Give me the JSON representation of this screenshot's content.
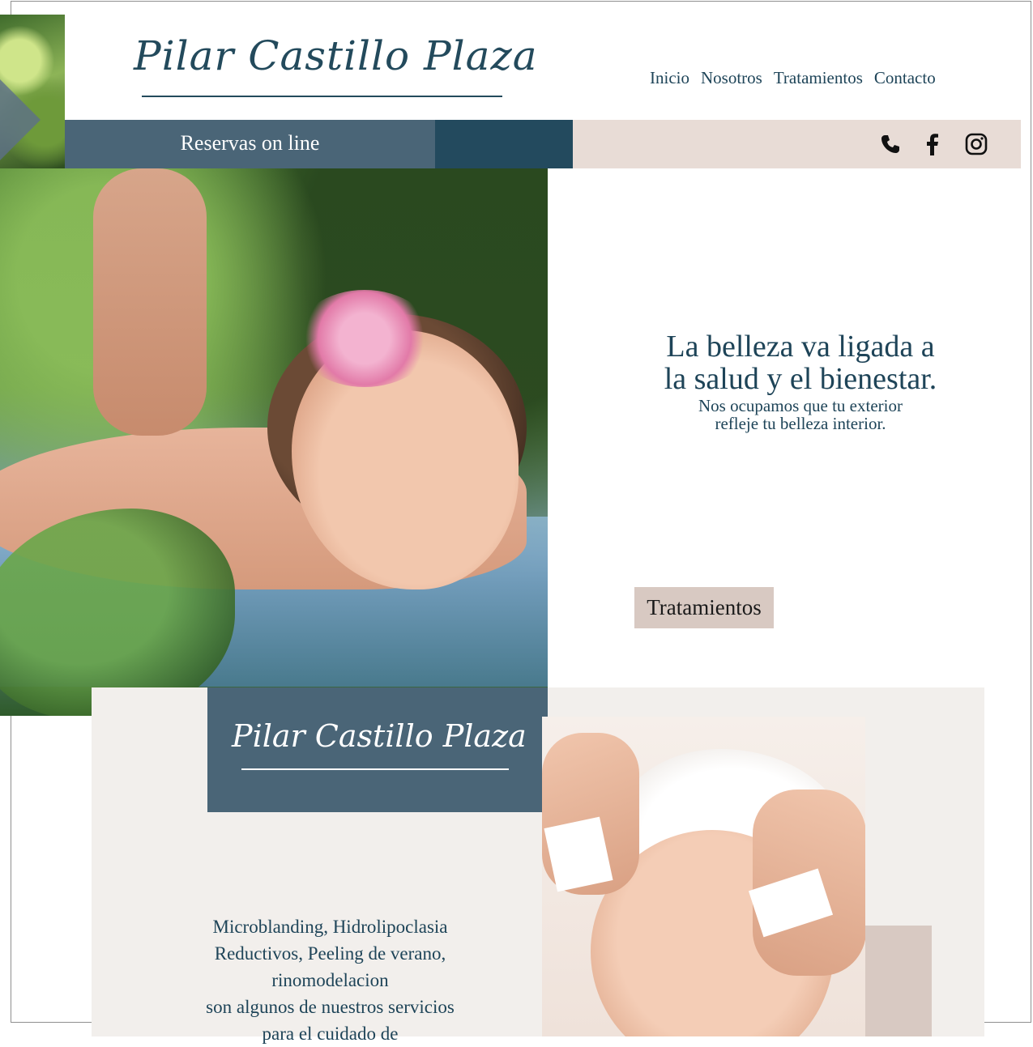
{
  "brand": {
    "logo_text": "Pilar Castillo Plaza"
  },
  "nav": {
    "items": [
      "Inicio",
      "Nosotros",
      "Tratamientos",
      "Contacto"
    ]
  },
  "bar": {
    "booking_label": "Reservas on line"
  },
  "social": {
    "icons": [
      "phone-icon",
      "facebook-icon",
      "instagram-icon"
    ]
  },
  "hero": {
    "tagline_line1": "La belleza va ligada a",
    "tagline_line2": "la salud y el bienestar.",
    "sub_line1": "Nos ocupamos que tu exterior",
    "sub_line2": "refleje tu belleza interior.",
    "button_label": "Tratamientos"
  },
  "section2": {
    "logo_text": "Pilar Castillo Plaza",
    "services_lines": [
      "Microblanding, Hidrolipoclasia",
      "Reductivos, Peeling de verano,",
      "rinomodelacion",
      "son algunos de nuestros servicios",
      "para el cuidado de"
    ]
  },
  "colors": {
    "primary_dark": "#234a5e",
    "slate": "#4a6577",
    "beige": "#e8dcd6",
    "button_beige": "#d8c9c2",
    "section_bg": "#f2efec"
  }
}
